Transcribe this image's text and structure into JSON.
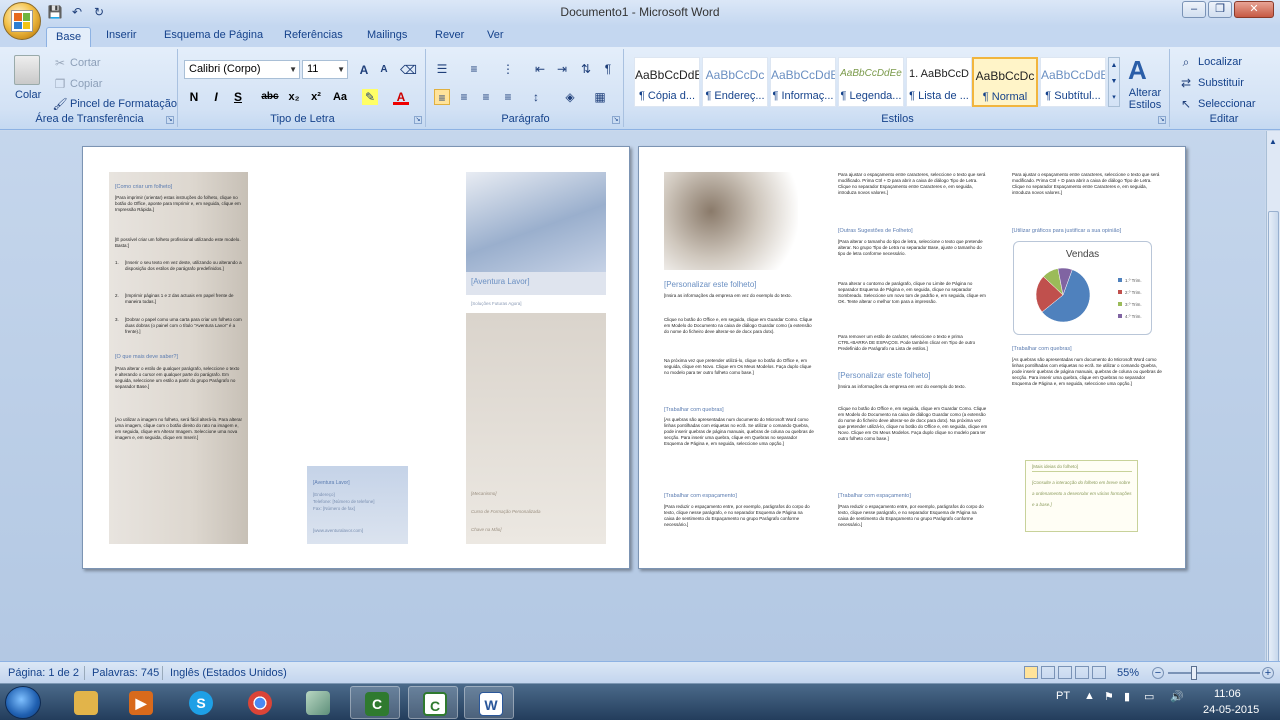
{
  "window": {
    "title": "Documento1 - Microsoft Word",
    "controls": {
      "minimize": "–",
      "maximize": "❐",
      "close": "✕"
    }
  },
  "qat": {
    "save": "💾",
    "undo": "↶",
    "redo": "↻"
  },
  "tabs": [
    "Base",
    "Inserir",
    "Esquema de Página",
    "Referências",
    "Mailings",
    "Rever",
    "Ver"
  ],
  "ribbon": {
    "clipboard": {
      "paste": "Colar",
      "cut": "Cortar",
      "copy": "Copiar",
      "format_painter": "Pincel de Formatação",
      "label": "Área de Transferência"
    },
    "font": {
      "name": "Calibri (Corpo)",
      "size": "11",
      "label": "Tipo de Letra",
      "buttons": [
        "N",
        "I",
        "S",
        "abc",
        "x₂",
        "x²",
        "Aa"
      ]
    },
    "paragraph": {
      "label": "Parágrafo"
    },
    "styles": {
      "label": "Estilos",
      "items": [
        {
          "preview": "AaBbCcDdE",
          "name": "¶ Cópia d..."
        },
        {
          "preview": "AaBbCcDc",
          "name": "¶ Endereç..."
        },
        {
          "preview": "AaBbCcDdE",
          "name": "¶ Informaç..."
        },
        {
          "preview": "AaBbCcDdEe",
          "name": "¶ Legenda..."
        },
        {
          "preview": "1. AaBbCcD",
          "name": "¶ Lista de ..."
        },
        {
          "preview": "AaBbCcDc",
          "name": "¶ Normal"
        },
        {
          "preview": "AaBbCcDdE",
          "name": "¶ Subtítul..."
        }
      ],
      "change_styles": "Alterar Estilos"
    },
    "edit": {
      "label": "Editar",
      "find": "Localizar",
      "replace": "Substituir",
      "select": "Seleccionar"
    }
  },
  "page1": {
    "left_heading": "[Como criar um folheto]",
    "left_p1": "[Para imprimir (orientar) estas instruções do folheto, clique no botão do Office, aponte para Imprimir e, em seguida, clique em Impressão Rápida.]",
    "left_p2": "[É possível criar um folheto profissional utilizando este modelo. Basta:]",
    "list": [
      "[Inserir o seu texto em vez deste, utilizando ou alterando a disposição dos estilos de parágrafo predefinidos.]",
      "[Imprimir páginas 1 e 2 das actuais em papel frente de maneira todas.]",
      "[Dobrar o papel como uma carta para criar um folheto com duas dobras (o painel com o título \"Aventura Lavor\" é a frente).]"
    ],
    "left_heading2": "[O que mais deve saber?]",
    "left_p3": "[Para alterar o estilo de qualquer parágrafo, seleccione o texto e alterando o cursor em qualquer parte do parágrafo. Em seguida, seleccione um estilo a partir do grupo Parágrafo no separador Base.]",
    "left_p4": "[Ao utilizar a imagem no folheto, será fácil alterá-la. Para alterar uma imagem, clique com o botão direito do rato na imagem e, em seguida, clique em Alterar Imagem. Seleccione uma nova imagem e, em seguida, clique em Inserir.]",
    "contact_title": "[Aventura Lavor]",
    "contact_lines": [
      "[Endereço]",
      "Telefone: [Número de telefone]",
      "Fax: [Número de fax]",
      "",
      "[www.aventuralavor.com]"
    ],
    "cover_title": "[Aventura Lavor]",
    "cover_sub": "[Soluções Futuras Agora]",
    "cover_lines": [
      "[Mecanismo]",
      "Curso de Formação Personalizada",
      "Chave na Mão]"
    ]
  },
  "page2": {
    "c1_heading": "[Personalizar este folheto]",
    "c1_p1": "[Insira as informações da empresa em vez do exemplo do texto.",
    "c1_p2": "Clique no botão do Office e, em seguida, clique em Guardar Como. Clique em Modelo do Documento na caixa de diálogo Guardar como (a extensão do nome do ficheiro deve alterar-se de docx para dotx).",
    "c1_p3": "Na próxima vez que pretender utilizá-lo, clique no botão do Office e, em seguida, clique em Novo. Clique em Os Meus Modelos. Faça duplo clique no modelo para ter outro folheto como base.]",
    "c1_h2": "[Trabalhar com quebras]",
    "c1_p4": "[As quebras são apresentadas num documento do Microsoft Word como linhas pontilhadas com etiquetas no ecrã. Se utilizar o comando Quebra, pode inserir quebras de página manuais, quebras de coluna ou quebras de secção. Para inserir uma quebra, clique em Quebras no separador Esquema de Página e, em seguida, seleccione uma opção.]",
    "c1_h3": "[Trabalhar com espaçamento]",
    "c1_p5": "[Para reduzir o espaçamento entre, por exemplo, parágrafos do corpo do texto, clique nesse parágrafo, e no separador Esquema de Página na caixa de sentimento do Espaçamento no grupo Parágrafo conforme necessário.]",
    "c2_p1": "Para ajustar o espaçamento entre caracteres, seleccione o texto que será modificado. Prima Ctrl + D para abrir a caixa de diálogo Tipo de Letra. Clique no separador Espaçamento entre Caracteres e, em seguida, introduza novos valores.]",
    "c2_h1": "[Outras Sugestões de Folheto]",
    "c2_p2": "[Para alterar o tamanho do tipo de letra, seleccione o texto que pretende alterar. No grupo Tipo de Letra no separador Base, ajuste o tamanho do tipo de letra conforme necessário.",
    "c2_p3": "Para alterar o contorno de parágrafo, clique no Limite de Página no separador Esquema de Página e, em seguida, clique no separador Sombreado. Seleccione um novo tom de padrão e, em seguida, clique em OK. Tente alterar o melhor tom para a impressão.",
    "c2_p4": "Para remover um estilo de carácter, seleccione o texto e prima CTRL+BARRA DE ESPAÇOS. Pode também clicar em Tipo de outro Predefinido de Parágrafo na Lista de estilos.]",
    "c2_h2": "[Personalizar este folheto]",
    "c2_p5": "[Insira as informações da empresa em vez do exemplo do texto.",
    "c2_p6": "Clique no botão do Office e, em seguida, clique em Guardar Como. Clique em Modelo do Documento na caixa de diálogo Guardar como (a extensão do nome do ficheiro deve alterar-se de docx para dotx). Na próxima vez que pretender utilizá-lo, clique no botão do Office e, em seguida, clique em Novo. Clique em Os Meus Modelos. Faça duplo clique no modelo para ter outro folheto como base.]",
    "c2_h3": "[Trabalhar com espaçamento]",
    "c2_p7": "[Para reduzir o espaçamento entre, por exemplo, parágrafos do corpo do texto, clique nesse parágrafo, e no separador Esquema de Página na caixa de sentimento do Espaçamento no grupo Parágrafo conforme necessário.]",
    "c3_p1": "Para ajustar o espaçamento entre caracteres, seleccione o texto que será modificado. Prima Ctrl + D para abrir a caixa de diálogo Tipo de Letra. Clique no separador Espaçamento entre Caracteres e, em seguida, introduza novos valores.]",
    "c3_h1": "[Utilizar gráficos para justificar a sua opinião]",
    "c3_h2": "[Trabalhar com quebras]",
    "c3_p2": "[As quebras são apresentadas num documento do Microsoft Word como linhas pontilhadas com etiquetas no ecrã. Se utilizar o comando Quebra, pode inserir quebras de página manuais, quebras de coluna ou quebras de secção. Para inserir uma quebra, clique em Quebras no separador Esquema de Página e, em seguida, seleccione uma opção.]",
    "box_title": "[Mais ideias do folheto]",
    "box_text": "[Consulte a interacção do folheto em breve sobre a ordenamento a desenrolar em várias formações e a base.]"
  },
  "chart_data": {
    "type": "pie",
    "title": "Vendas",
    "categories": [
      "1.º Trim.",
      "2.º Trim.",
      "3.º Trim.",
      "4.º Trim."
    ],
    "values": [
      8.2,
      3.2,
      1.4,
      1.2
    ],
    "colors": [
      "#4f81bd",
      "#c0504d",
      "#9bbb59",
      "#8064a2"
    ]
  },
  "status": {
    "page": "Página: 1 de 2",
    "words": "Palavras: 745",
    "lang": "Inglês (Estados Unidos)",
    "zoom": "55%"
  },
  "taskbar": {
    "lang": "PT",
    "time": "11:06",
    "date": "24-05-2015"
  }
}
